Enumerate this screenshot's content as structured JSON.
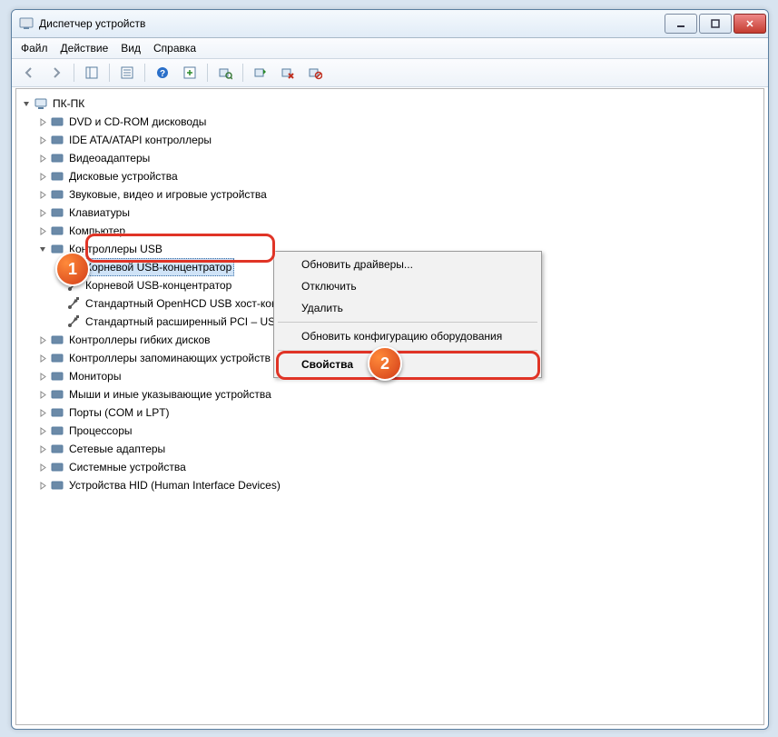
{
  "window": {
    "title": "Диспетчер устройств"
  },
  "menu": {
    "file": "Файл",
    "action": "Действие",
    "view": "Вид",
    "help": "Справка"
  },
  "root": "ПК-ПК",
  "categories": [
    {
      "label": "DVD и CD-ROM дисководы"
    },
    {
      "label": "IDE ATA/ATAPI контроллеры"
    },
    {
      "label": "Видеоадаптеры"
    },
    {
      "label": "Дисковые устройства"
    },
    {
      "label": "Звуковые, видео и игровые устройства"
    },
    {
      "label": "Клавиатуры"
    },
    {
      "label": "Компьютер"
    },
    {
      "label": "Контроллеры USB",
      "expanded": true,
      "children": [
        {
          "label": "Корневой USB-концентратор",
          "selected": true
        },
        {
          "label": "Корневой USB-концентратор"
        },
        {
          "label": "Стандартный OpenHCD USB хост-контроллер"
        },
        {
          "label": "Стандартный расширенный PCI – USB хост-контроллер"
        }
      ]
    },
    {
      "label": "Контроллеры гибких дисков"
    },
    {
      "label": "Контроллеры запоминающих устройств"
    },
    {
      "label": "Мониторы"
    },
    {
      "label": "Мыши и иные указывающие устройства"
    },
    {
      "label": "Порты (COM и LPT)"
    },
    {
      "label": "Процессоры"
    },
    {
      "label": "Сетевые адаптеры"
    },
    {
      "label": "Системные устройства"
    },
    {
      "label": "Устройства HID (Human Interface Devices)"
    }
  ],
  "context_menu": {
    "items": [
      "Обновить драйверы...",
      "Отключить",
      "Удалить",
      "-",
      "Обновить конфигурацию оборудования",
      "-",
      "Свойства"
    ],
    "highlighted": "Свойства"
  },
  "annotations": {
    "badge1": "1",
    "badge2": "2"
  }
}
